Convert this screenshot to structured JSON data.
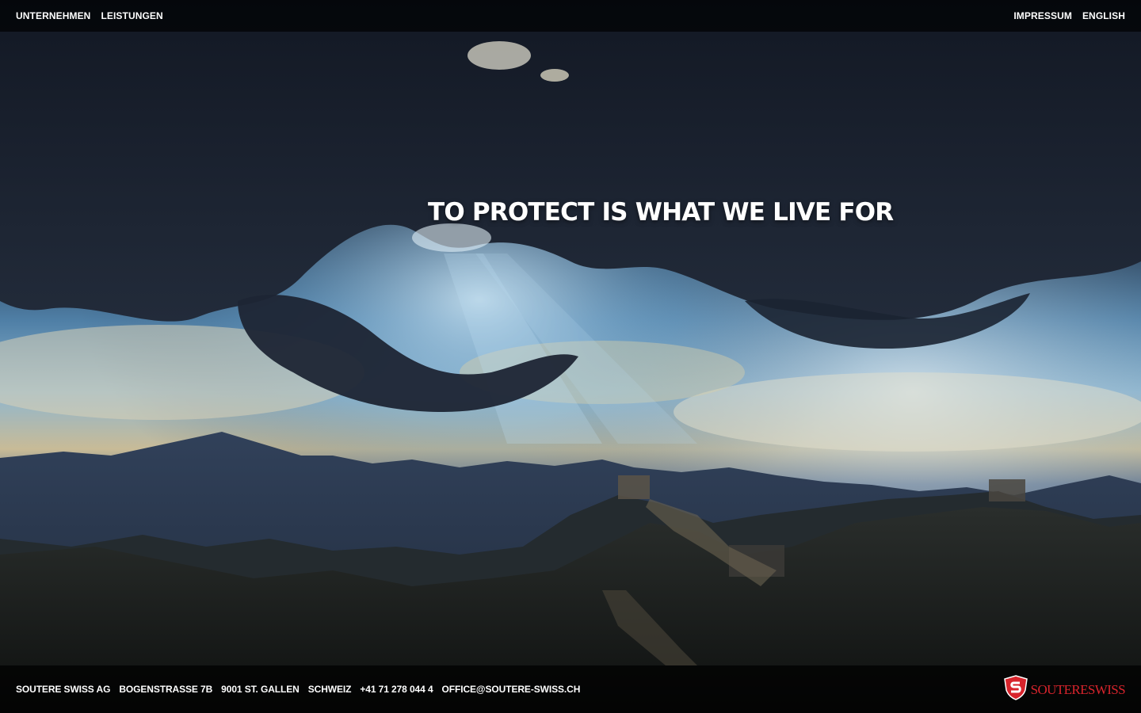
{
  "nav": {
    "left": [
      {
        "label": "UNTERNEHMEN"
      },
      {
        "label": "LEISTUNGEN"
      }
    ],
    "right": [
      {
        "label": "IMPRESSUM"
      },
      {
        "label": "ENGLISH"
      }
    ]
  },
  "hero": {
    "headline": "TO PROTECT IS WHAT WE LIVE FOR",
    "background_image": "great-wall-mountains-sunrays"
  },
  "footer": {
    "company": "SOUTERE SWISS AG",
    "street": "BOGENSTRASSE 7B",
    "city": "9001 ST. GALLEN",
    "country": "SCHWEIZ",
    "phone": "+41 71 278 044 4",
    "email": "OFFICE@SOUTERE-SWISS.CH"
  },
  "logo": {
    "text": "SOUTERESWISS",
    "icon": "shield-icon",
    "color": "#d8242c"
  },
  "colors": {
    "bar_background": "#000000",
    "text": "#ffffff",
    "brand": "#d8242c"
  }
}
